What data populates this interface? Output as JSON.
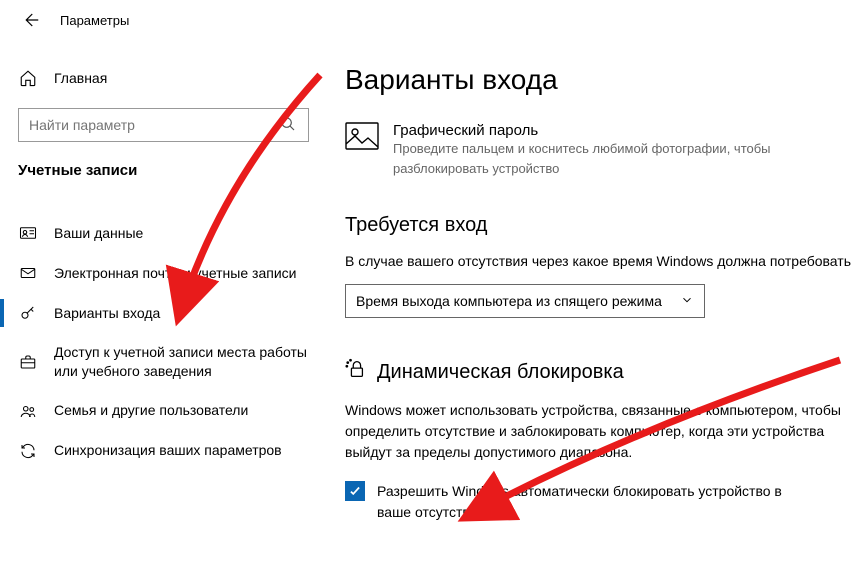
{
  "header": {
    "title": "Параметры"
  },
  "sidebar": {
    "home_label": "Главная",
    "search_placeholder": "Найти параметр",
    "section_title": "Учетные записи",
    "items": [
      {
        "label": "Ваши данные"
      },
      {
        "label": "Электронная почта и учетные записи"
      },
      {
        "label": "Варианты входа"
      },
      {
        "label": "Доступ к учетной записи места работы или учебного заведения"
      },
      {
        "label": "Семья и другие пользователи"
      },
      {
        "label": "Синхронизация ваших параметров"
      }
    ]
  },
  "content": {
    "page_title": "Варианты входа",
    "picture_password": {
      "title": "Графический пароль",
      "desc": "Проведите пальцем и коснитесь любимой фотографии, чтобы разблокировать устройство"
    },
    "require_signin": {
      "title": "Требуется вход",
      "desc": "В случае вашего отсутствия через какое время Windows должна потребовать",
      "dropdown": "Время выхода компьютера из спящего режима"
    },
    "dynamic_lock": {
      "title": "Динамическая блокировка",
      "desc": "Windows может использовать устройства, связанные с компьютером, чтобы определить отсутствие и заблокировать компьютер, когда эти устройства выйдут за пределы допустимого диапазона.",
      "checkbox_label": "Разрешить Windows автоматически блокировать устройство в ваше отсутствие"
    }
  }
}
